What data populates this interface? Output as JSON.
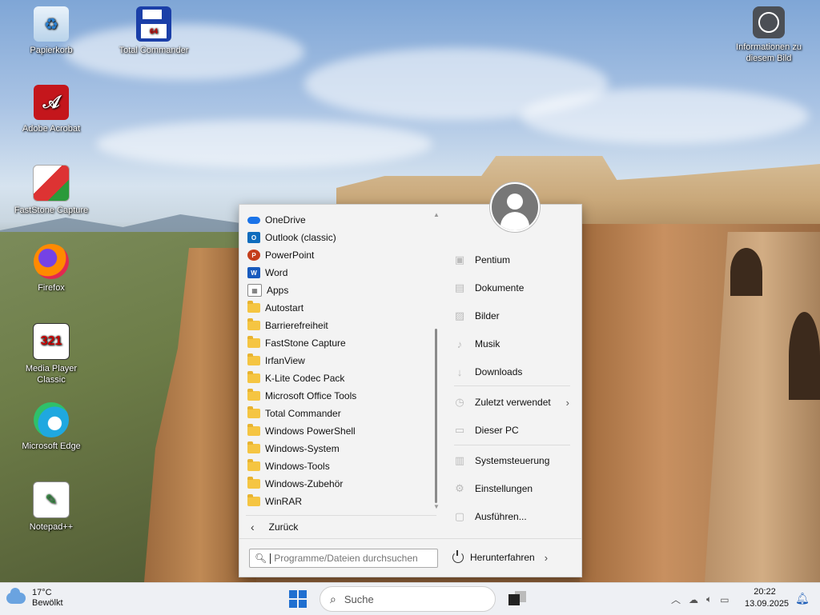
{
  "desktop": {
    "icons": [
      {
        "label": "Papierkorb",
        "icon": "recycle-bin-icon"
      },
      {
        "label": "Total Commander",
        "icon": "floppy-disk-icon"
      },
      {
        "label": "Informationen zu diesem Bild",
        "icon": "camera-info-icon"
      },
      {
        "label": "Adobe Acrobat",
        "icon": "adobe-acrobat-icon"
      },
      {
        "label": "FastStone Capture",
        "icon": "faststone-icon"
      },
      {
        "label": "Firefox",
        "icon": "firefox-icon"
      },
      {
        "label": "Media Player Classic",
        "icon": "clapperboard-icon"
      },
      {
        "label": "Microsoft Edge",
        "icon": "edge-icon"
      },
      {
        "label": "Notepad++",
        "icon": "notepad-plus-icon"
      }
    ],
    "badges": {
      "total_commander": "64",
      "media_player": "321"
    }
  },
  "start_menu": {
    "programs": [
      {
        "label": "OneDrive",
        "type": "app",
        "color": "#1a73e8"
      },
      {
        "label": "Outlook (classic)",
        "type": "app",
        "color": "#0f6cbd"
      },
      {
        "label": "PowerPoint",
        "type": "app",
        "color": "#c43e1c"
      },
      {
        "label": "Word",
        "type": "app",
        "color": "#185abd"
      },
      {
        "label": "Apps",
        "type": "app",
        "color": "#5a5a5a"
      },
      {
        "label": "Autostart",
        "type": "folder"
      },
      {
        "label": "Barrierefreiheit",
        "type": "folder"
      },
      {
        "label": "FastStone Capture",
        "type": "folder"
      },
      {
        "label": "IrfanView",
        "type": "folder"
      },
      {
        "label": "K-Lite Codec Pack",
        "type": "folder"
      },
      {
        "label": "Microsoft Office Tools",
        "type": "folder"
      },
      {
        "label": "Total Commander",
        "type": "folder"
      },
      {
        "label": "Windows PowerShell",
        "type": "folder"
      },
      {
        "label": "Windows-System",
        "type": "folder"
      },
      {
        "label": "Windows-Tools",
        "type": "folder"
      },
      {
        "label": "Windows-Zubehör",
        "type": "folder"
      },
      {
        "label": "WinRAR",
        "type": "folder"
      }
    ],
    "back_label": "Zurück",
    "right_items": [
      {
        "label": "Pentium",
        "icon": "user-folder-icon"
      },
      {
        "label": "Dokumente",
        "icon": "document-icon"
      },
      {
        "label": "Bilder",
        "icon": "picture-icon"
      },
      {
        "label": "Musik",
        "icon": "music-icon"
      },
      {
        "label": "Downloads",
        "icon": "download-icon"
      },
      {
        "label": "Zuletzt verwendet",
        "icon": "clock-icon",
        "arrow": true
      },
      {
        "label": "Dieser PC",
        "icon": "computer-icon"
      },
      {
        "label": "Systemsteuerung",
        "icon": "control-panel-icon"
      },
      {
        "label": "Einstellungen",
        "icon": "gear-icon"
      },
      {
        "label": "Ausführen...",
        "icon": "run-icon"
      }
    ],
    "search_placeholder": "Programme/Dateien durchsuchen",
    "shutdown_label": "Herunterfahren"
  },
  "taskbar": {
    "weather_temp": "17°C",
    "weather_desc": "Bewölkt",
    "search_placeholder": "Suche",
    "time": "20:22",
    "date": "13.09.2025"
  }
}
